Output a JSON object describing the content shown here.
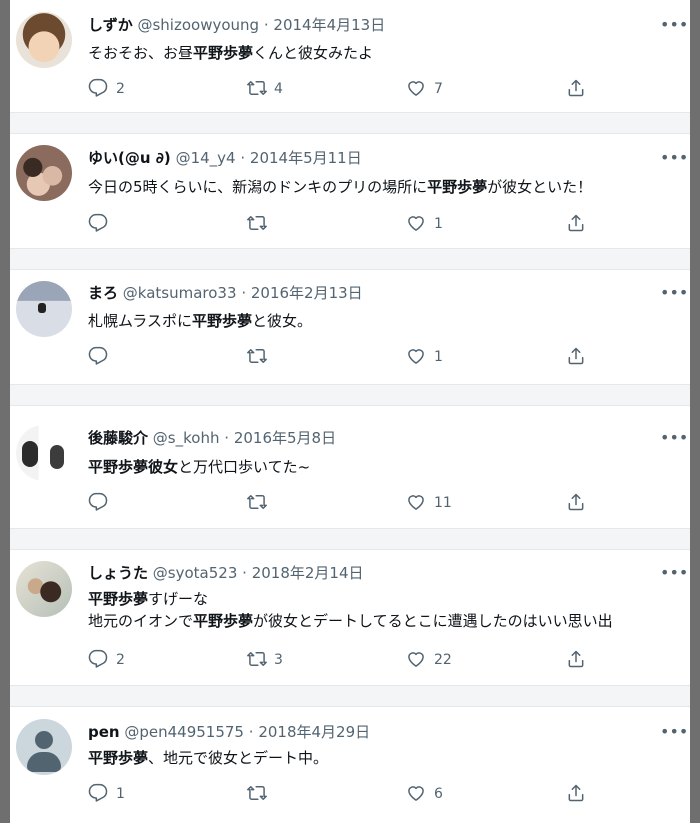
{
  "tweets": [
    {
      "name": "しずか",
      "handle": "@shizoowyoung",
      "dot": "·",
      "date": "2014年4月13日",
      "lines": [
        [
          {
            "t": "そおそお、お昼",
            "b": false
          },
          {
            "t": "平野歩夢",
            "b": true
          },
          {
            "t": "くんと彼女みたよ",
            "b": false
          }
        ]
      ],
      "reply": "2",
      "retweet": "4",
      "like": "7"
    },
    {
      "name": "ゆい(@u ∂)",
      "handle": "@14_y4",
      "dot": "·",
      "date": "2014年5月11日",
      "lines": [
        [
          {
            "t": "今日の5時くらいに、新潟のドンキのプリの場所に",
            "b": false
          },
          {
            "t": "平野歩夢",
            "b": true
          },
          {
            "t": "が彼女といた！",
            "b": false
          }
        ]
      ],
      "reply": "",
      "retweet": "",
      "like": "1"
    },
    {
      "name": "まろ",
      "handle": "@katsumaro33",
      "dot": "·",
      "date": "2016年2月13日",
      "lines": [
        [
          {
            "t": "札幌ムラスポに",
            "b": false
          },
          {
            "t": "平野歩夢",
            "b": true
          },
          {
            "t": "と彼女。",
            "b": false
          }
        ]
      ],
      "reply": "",
      "retweet": "",
      "like": "1"
    },
    {
      "name": "後藤駿介",
      "handle": "@s_kohh",
      "dot": "·",
      "date": "2016年5月8日",
      "lines": [
        [
          {
            "t": "平野歩夢彼女",
            "b": true
          },
          {
            "t": "と万代口歩いてた~",
            "b": false
          }
        ]
      ],
      "reply": "",
      "retweet": "",
      "like": "11"
    },
    {
      "name": "しょうた",
      "handle": "@syota523",
      "dot": "·",
      "date": "2018年2月14日",
      "lines": [
        [
          {
            "t": "平野歩夢",
            "b": true
          },
          {
            "t": "すげーな",
            "b": false
          }
        ],
        [
          {
            "t": "地元のイオンで",
            "b": false
          },
          {
            "t": "平野歩夢",
            "b": true
          },
          {
            "t": "が彼女とデートしてるとこに遭遇したのはいい思い出",
            "b": false
          }
        ]
      ],
      "reply": "2",
      "retweet": "3",
      "like": "22"
    },
    {
      "name": "pen",
      "handle": "@pen44951575",
      "dot": "·",
      "date": "2018年4月29日",
      "lines": [
        [
          {
            "t": "平野歩夢",
            "b": true
          },
          {
            "t": "、地元で彼女とデート中。",
            "b": false
          }
        ]
      ],
      "reply": "1",
      "retweet": "",
      "like": "6"
    }
  ],
  "icons": {
    "more": "more-icon",
    "reply": "reply-icon",
    "retweet": "retweet-icon",
    "like": "like-icon",
    "share": "share-icon"
  },
  "colors": {
    "text": "#0f1419",
    "muted": "#536471",
    "separator": "#f4f5f7"
  }
}
